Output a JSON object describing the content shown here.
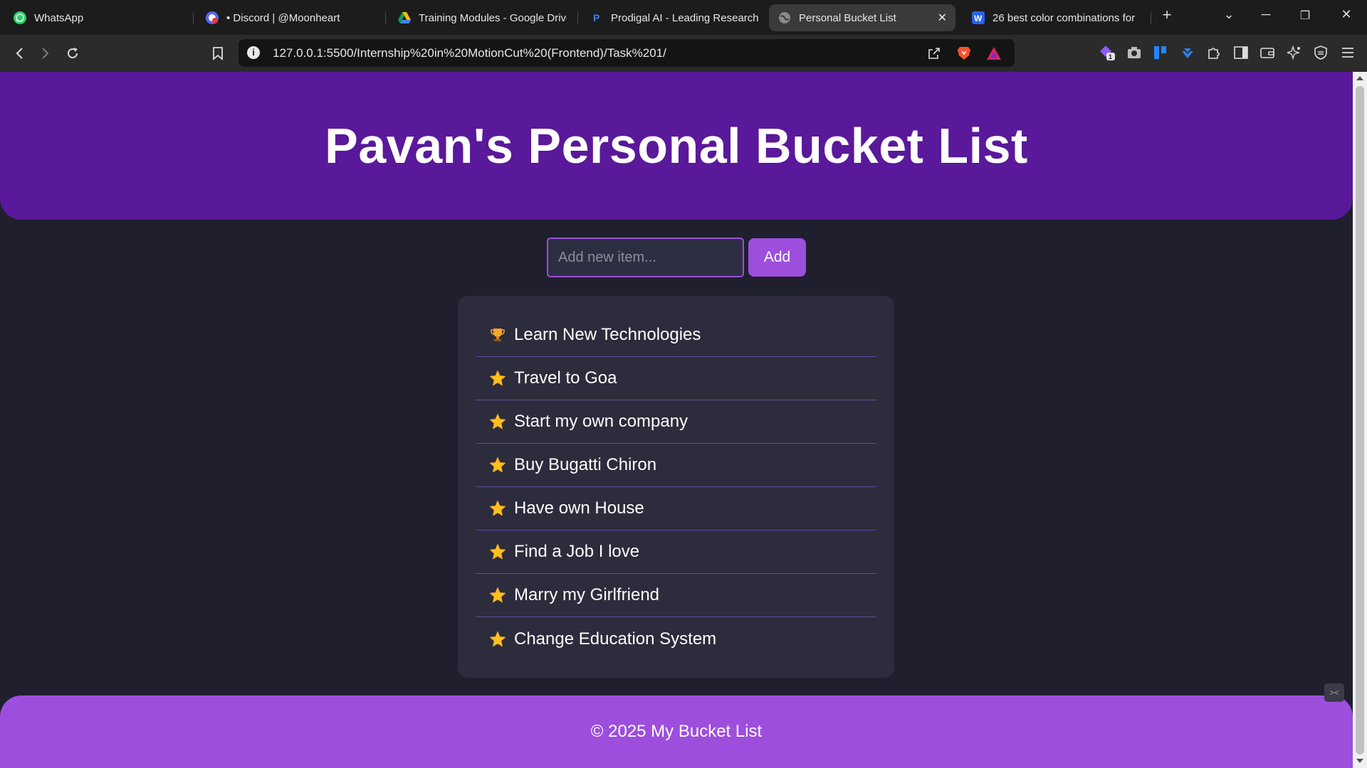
{
  "browser": {
    "tabs": [
      {
        "label": "WhatsApp",
        "icon": "whatsapp-icon"
      },
      {
        "label": "• Discord | @Moonheart",
        "icon": "discord-icon"
      },
      {
        "label": "Training Modules - Google Drive",
        "icon": "google-drive-icon"
      },
      {
        "label": "Prodigal AI - Leading Research",
        "icon": "prodigal-icon"
      },
      {
        "label": "Personal Bucket List",
        "icon": "globe-icon",
        "active": true
      },
      {
        "label": "26 best color combinations for",
        "icon": "w-icon"
      }
    ],
    "url": "127.0.0.1:5500/Internship%20in%20MotionCut%20(Frontend)/Task%201/",
    "wallet_badge": "1"
  },
  "page": {
    "title": "Pavan's Personal Bucket List",
    "input_placeholder": "Add new item...",
    "add_label": "Add",
    "items": [
      {
        "text": "Learn New Technologies",
        "icon": "trophy-icon"
      },
      {
        "text": "Travel to Goa",
        "icon": "star-icon"
      },
      {
        "text": "Start my own company",
        "icon": "star-icon"
      },
      {
        "text": "Buy Bugatti Chiron",
        "icon": "star-icon"
      },
      {
        "text": "Have own House",
        "icon": "star-icon"
      },
      {
        "text": "Find a Job I love",
        "icon": "star-icon"
      },
      {
        "text": "Marry my Girlfriend",
        "icon": "star-icon"
      },
      {
        "text": "Change Education System",
        "icon": "star-icon"
      }
    ],
    "footer": "© 2025 My Bucket List"
  },
  "colors": {
    "header": "#5a189a",
    "accent": "#9d4edd",
    "background": "#1f1f2e",
    "card": "#2c2c3c"
  }
}
